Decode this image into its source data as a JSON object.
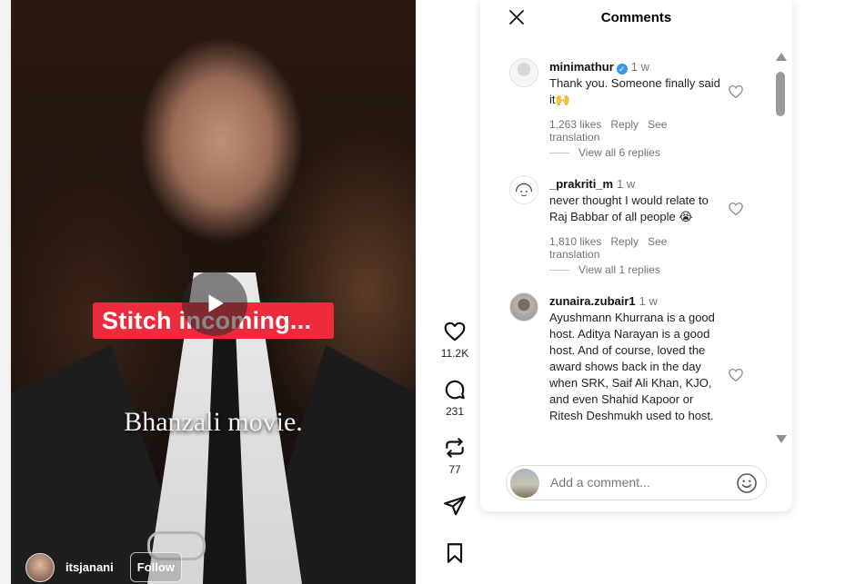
{
  "video": {
    "stitch_text": "Stitch incoming...",
    "caption": "Bhanzali movie.",
    "author": {
      "username": "itsjanani",
      "follow_label": "Follow"
    }
  },
  "actions": {
    "like_count": "11.2K",
    "comment_count": "231",
    "repost_count": "77"
  },
  "comments_panel": {
    "title": "Comments",
    "comments": [
      {
        "username": "minimathur",
        "verified": true,
        "time": "1 w",
        "text": "Thank you. Someone finally said it🙌",
        "likes": "1,263 likes",
        "reply_label": "Reply",
        "translation_label": "See translation",
        "replies_label": "View all 6 replies"
      },
      {
        "username": "_prakriti_m",
        "verified": false,
        "time": "1 w",
        "text": "never thought I would relate to Raj Babbar of all people 😭",
        "likes": "1,810 likes",
        "reply_label": "Reply",
        "translation_label": "See translation",
        "replies_label": "View all 1 replies"
      },
      {
        "username": "zunaira.zubair1",
        "verified": false,
        "time": "1 w",
        "text": "Ayushmann Khurrana is a good host. Aditya Narayan is a good host. And of course, loved the award shows back in the day when SRK, Saif Ali Khan, KJO, and even Shahid Kapoor or Ritesh Deshmukh used to host."
      }
    ],
    "add_comment_placeholder": "Add a comment..."
  },
  "colors": {
    "stitch_banner": "#ee2b3c",
    "verified_badge": "#3797f0"
  },
  "icons": [
    "close-icon",
    "heart-icon",
    "comment-icon",
    "repost-icon",
    "share-icon",
    "bookmark-icon",
    "play-icon",
    "emoji-icon"
  ]
}
